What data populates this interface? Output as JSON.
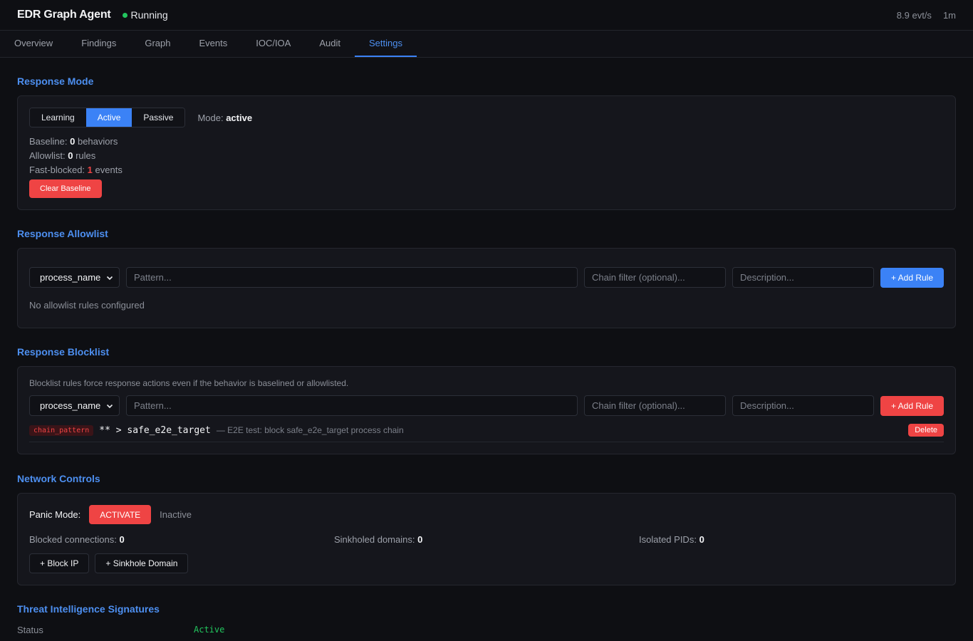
{
  "header": {
    "app_title": "EDR Graph Agent",
    "status_text": "Running",
    "status_color": "#22c55e",
    "event_rate": "8.9 evt/s",
    "uptime": "1m"
  },
  "tabs": [
    {
      "label": "Overview"
    },
    {
      "label": "Findings"
    },
    {
      "label": "Graph"
    },
    {
      "label": "Events"
    },
    {
      "label": "IOC/IOA"
    },
    {
      "label": "Audit"
    },
    {
      "label": "Settings",
      "active": true
    }
  ],
  "response_mode": {
    "title": "Response Mode",
    "options": [
      "Learning",
      "Active",
      "Passive"
    ],
    "selected": "Active",
    "mode_prefix": "Mode:",
    "mode_value": "active",
    "baseline_label": "Baseline:",
    "baseline_count": "0",
    "baseline_unit": "behaviors",
    "allowlist_label": "Allowlist:",
    "allowlist_count": "0",
    "allowlist_unit": "rules",
    "fastblocked_label": "Fast-blocked:",
    "fastblocked_count": "1",
    "fastblocked_unit": "events",
    "clear_button": "Clear Baseline"
  },
  "allowlist": {
    "title": "Response Allowlist",
    "select_value": "process_name",
    "pattern_placeholder": "Pattern...",
    "chain_placeholder": "Chain filter (optional)...",
    "description_placeholder": "Description...",
    "add_button": "+ Add Rule",
    "empty_text": "No allowlist rules configured"
  },
  "blocklist": {
    "title": "Response Blocklist",
    "description": "Blocklist rules force response actions even if the behavior is baselined or allowlisted.",
    "select_value": "process_name",
    "pattern_placeholder": "Pattern...",
    "chain_placeholder": "Chain filter (optional)...",
    "description_placeholder": "Description...",
    "add_button": "+ Add Rule",
    "rules": [
      {
        "type": "chain_pattern",
        "pattern": "** > safe_e2e_target",
        "description": "— E2E test: block safe_e2e_target process chain",
        "delete_label": "Delete"
      }
    ]
  },
  "network": {
    "title": "Network Controls",
    "panic_label": "Panic Mode:",
    "activate_button": "ACTIVATE",
    "panic_state": "Inactive",
    "blocked_label": "Blocked connections:",
    "blocked_count": "0",
    "sinkholed_label": "Sinkholed domains:",
    "sinkholed_count": "0",
    "isolated_label": "Isolated PIDs:",
    "isolated_count": "0",
    "block_ip_button": "+ Block IP",
    "sinkhole_button": "+ Sinkhole Domain"
  },
  "threat_intel": {
    "title": "Threat Intelligence Signatures",
    "status_label": "Status",
    "status_value": "Active"
  }
}
